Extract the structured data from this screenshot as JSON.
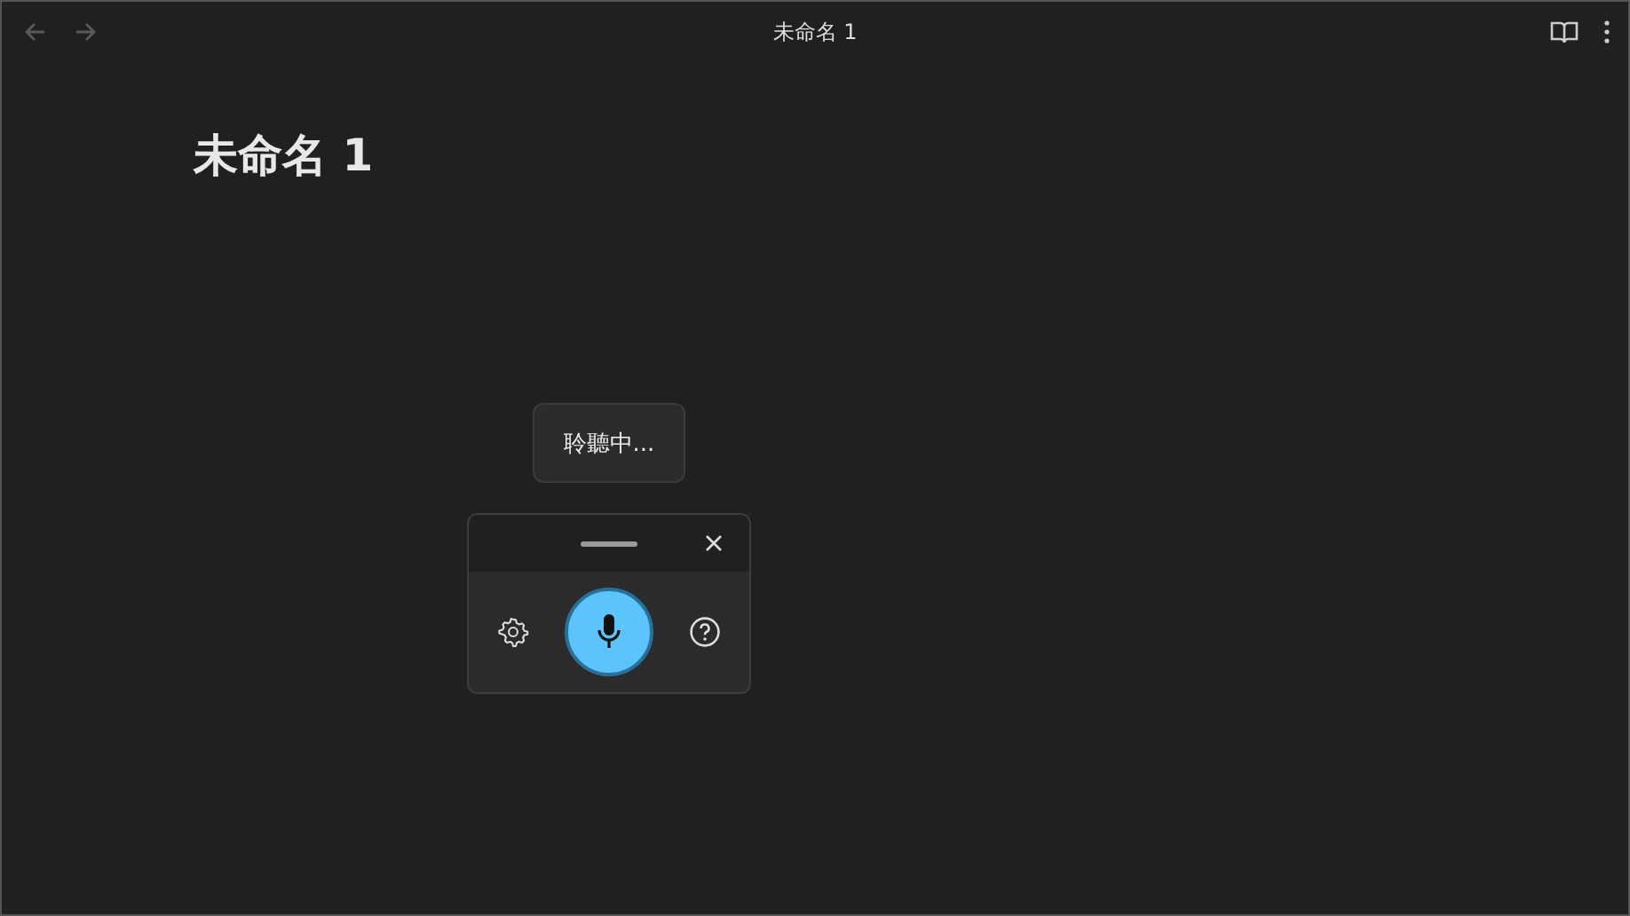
{
  "window": {
    "title": "未命名 1"
  },
  "navigation": [
    {
      "kind": "back",
      "disabled": true
    },
    {
      "kind": "forward",
      "disabled": true
    }
  ],
  "document": {
    "heading": "未命名 1"
  },
  "voice_panel": {
    "tooltip": "聆聽中...",
    "listening": true
  }
}
